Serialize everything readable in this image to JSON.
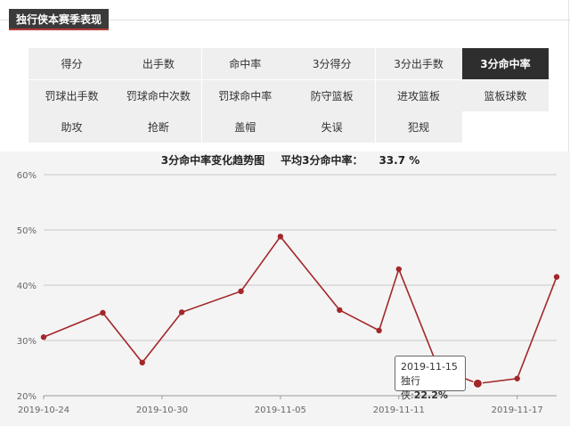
{
  "header": {
    "title": "独行侠本赛季表现"
  },
  "stat_tabs": [
    {
      "label": "得分",
      "active": false
    },
    {
      "label": "出手数",
      "active": false
    },
    {
      "label": "命中率",
      "active": false
    },
    {
      "label": "3分得分",
      "active": false
    },
    {
      "label": "3分出手数",
      "active": false
    },
    {
      "label": "3分命中率",
      "active": true
    },
    {
      "label": "罚球出手数",
      "active": false
    },
    {
      "label": "罚球命中次数",
      "active": false
    },
    {
      "label": "罚球命中率",
      "active": false
    },
    {
      "label": "防守篮板",
      "active": false
    },
    {
      "label": "进攻篮板",
      "active": false
    },
    {
      "label": "篮板球数",
      "active": false
    },
    {
      "label": "助攻",
      "active": false
    },
    {
      "label": "抢断",
      "active": false
    },
    {
      "label": "盖帽",
      "active": false
    },
    {
      "label": "失误",
      "active": false
    },
    {
      "label": "犯规",
      "active": false
    }
  ],
  "chart_header": {
    "title": "3分命中率变化趋势图",
    "average_label": "平均3分命中率：",
    "average_value": "33.7 %"
  },
  "tooltip": {
    "date": "2019-11-15",
    "series_label": "独行侠:",
    "value_text": "22.2%"
  },
  "colors": {
    "series": "#a3272a",
    "active_tab": "#2e2e2e",
    "grid": "#c8c8c8"
  },
  "chart_data": {
    "type": "line",
    "title": "3分命中率变化趋势图",
    "x": [
      "2019-10-24",
      "2019-10-27",
      "2019-10-29",
      "2019-10-31",
      "2019-11-03",
      "2019-11-05",
      "2019-11-08",
      "2019-11-10",
      "2019-11-11",
      "2019-11-13",
      "2019-11-15",
      "2019-11-17",
      "2019-11-19"
    ],
    "series": [
      {
        "name": "独行侠",
        "values": [
          30.6,
          35.0,
          26.0,
          35.1,
          38.9,
          48.8,
          35.5,
          31.8,
          42.9,
          25.0,
          22.2,
          23.1,
          41.5
        ]
      }
    ],
    "x_tick_labels": [
      "2019-10-24",
      "2019-10-30",
      "2019-11-05",
      "2019-11-11",
      "2019-11-17"
    ],
    "y_tick_labels": [
      "20%",
      "30%",
      "40%",
      "50%",
      "60%"
    ],
    "ylim": [
      20,
      60
    ],
    "xlim": [
      "2019-10-24",
      "2019-11-19"
    ],
    "highlighted_point": "2019-11-15",
    "grid": true,
    "legend": "none"
  }
}
